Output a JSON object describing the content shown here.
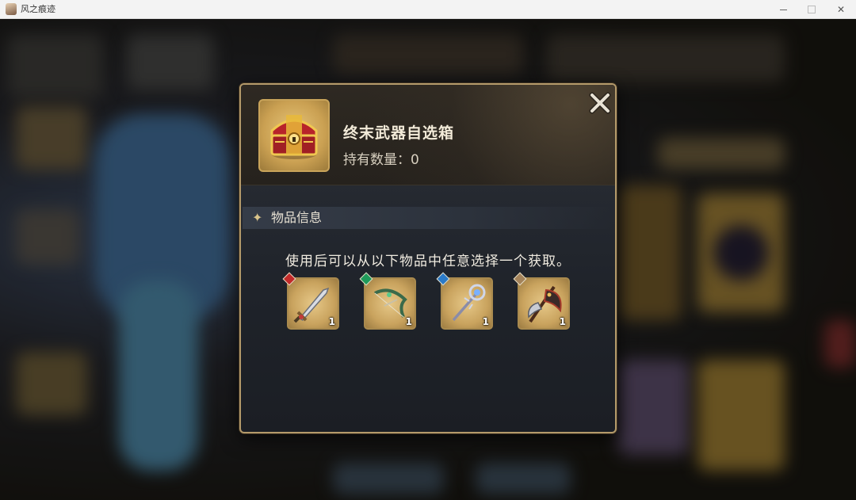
{
  "window": {
    "title": "风之痕迹",
    "close_glyph": "✕"
  },
  "dialog": {
    "item": {
      "icon": "treasure-chest-icon",
      "name": "终末武器自选箱",
      "count_label": "持有数量：0"
    },
    "close_icon": "close-x-icon",
    "section": {
      "icon": "sparkle-icon",
      "title": "物品信息"
    },
    "description": "使用后可以从以下物品中任意选择一个获取。",
    "rewards": [
      {
        "icon": "sword-icon",
        "element": "fire",
        "element_color": "#c22a2a",
        "quantity": "1"
      },
      {
        "icon": "bow-icon",
        "element": "wind",
        "element_color": "#1f9a5a",
        "quantity": "1"
      },
      {
        "icon": "staff-icon",
        "element": "water",
        "element_color": "#2a7ac8",
        "quantity": "1"
      },
      {
        "icon": "axe-icon",
        "element": "earth",
        "element_color": "#a4835a",
        "quantity": "1"
      }
    ]
  },
  "colors": {
    "frame_gold": "#b49a6a",
    "dialog_bg": "#1f232a"
  }
}
